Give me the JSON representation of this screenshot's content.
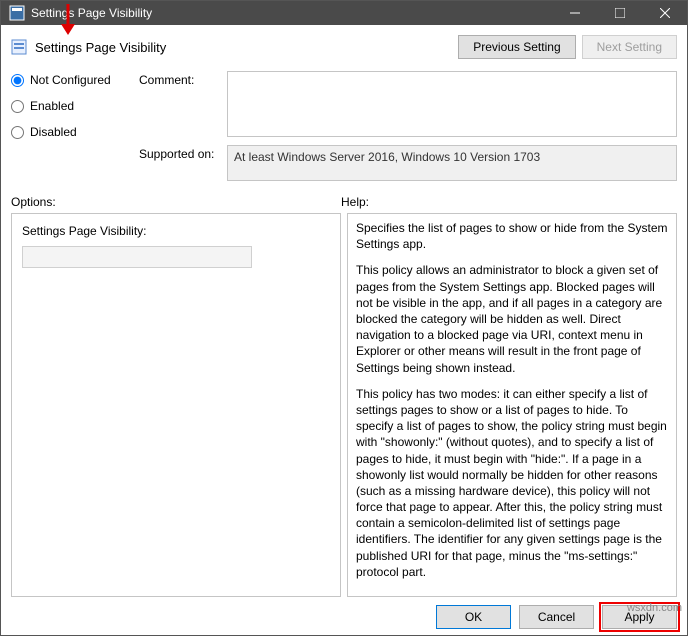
{
  "window": {
    "title": "Settings Page Visibility"
  },
  "header": {
    "title": "Settings Page Visibility",
    "prev": "Previous Setting",
    "next": "Next Setting"
  },
  "radios": {
    "not_configured": "Not Configured",
    "enabled": "Enabled",
    "disabled": "Disabled"
  },
  "labels": {
    "comment": "Comment:",
    "supported": "Supported on:",
    "options": "Options:",
    "help": "Help:"
  },
  "supported_text": "At least Windows Server 2016, Windows 10 Version 1703",
  "options": {
    "field_label": "Settings Page Visibility:",
    "field_value": ""
  },
  "help": {
    "p1": "Specifies the list of pages to show or hide from the System Settings app.",
    "p2": "This policy allows an administrator to block a given set of pages from the System Settings app. Blocked pages will not be visible in the app, and if all pages in a category are blocked the category will be hidden as well. Direct navigation to a blocked page via URI, context menu in Explorer or other means will result in the front page of Settings being shown instead.",
    "p3": "This policy has two modes: it can either specify a list of settings pages to show or a list of pages to hide. To specify a list of pages to show, the policy string must begin with \"showonly:\" (without quotes), and to specify a list of pages to hide, it must begin with \"hide:\". If a page in a showonly list would normally be hidden for other reasons (such as a missing hardware device), this policy will not force that page to appear. After this, the policy string must contain a semicolon-delimited list of settings page identifiers. The identifier for any given settings page is the published URI for that page, minus the \"ms-settings:\" protocol part."
  },
  "footer": {
    "ok": "OK",
    "cancel": "Cancel",
    "apply": "Apply"
  },
  "watermark": "wsxdn.com"
}
